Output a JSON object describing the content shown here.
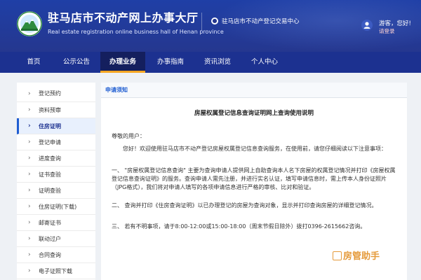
{
  "header": {
    "title": "驻马店市不动产网上办事大厅",
    "subtitle": "Real estate registration online business hall of Henan province",
    "center_name": "驻马店市不动产登记交易中心",
    "greeting": "游客，您好!",
    "login_label": "请登录"
  },
  "nav": {
    "items": [
      {
        "label": "首页"
      },
      {
        "label": "公示公告"
      },
      {
        "label": "办理业务"
      },
      {
        "label": "办事指南"
      },
      {
        "label": "资讯浏览"
      },
      {
        "label": "个人中心"
      }
    ],
    "active_index": 2
  },
  "sidebar": {
    "items": [
      {
        "label": "登记预约"
      },
      {
        "label": "资料预审"
      },
      {
        "label": "住房证明"
      },
      {
        "label": "登记申请"
      },
      {
        "label": "进度查询"
      },
      {
        "label": "证书查验"
      },
      {
        "label": "证明查验"
      },
      {
        "label": "住房证明(下载)"
      },
      {
        "label": "邮寄证书"
      },
      {
        "label": "联动过户"
      },
      {
        "label": "合同查询"
      },
      {
        "label": "电子证照下载"
      }
    ],
    "active_index": 2
  },
  "content": {
    "header": "申请须知",
    "doc_title": "房屋权属登记信息查询证明网上查询使用说明",
    "salutation": "尊敬的用户：",
    "intro": "您好！欢迎使用驻马店市不动产登记房屋权属登记信息查询服务，在使用前，请您仔细阅读以下注意事项：",
    "item1": "一、 \"房屋权属登记信息查询\" 主要为查询申请人提供网上自助查询本人名下房屋的权属登记情况并打印《房屋权属登记信息查询证明》的服务。查询申请人需先注册，并进行实名认证，填写申请信息时，需上传本人身份证照片（JPG格式），我们将对申请人填写的各项申请信息进行严格的审核、比对和验证。",
    "item2": "二、   查询并打印《住房查询证明》以已办理登记的房屋为查询对象，显示并打印查询房屋的详细登记情况。",
    "item3": "三、   若有不明事项，请于8:00-12:00或15:00-18:00（周末节假日除外）拨打0396-2615662咨询。",
    "watermark": "房管助手"
  },
  "colors": {
    "header_bg": "#25378f",
    "nav_bg": "#1c3190",
    "nav_active_bg": "#141f5e",
    "accent": "#1f5dd1",
    "watermark": "#e59a3a"
  }
}
